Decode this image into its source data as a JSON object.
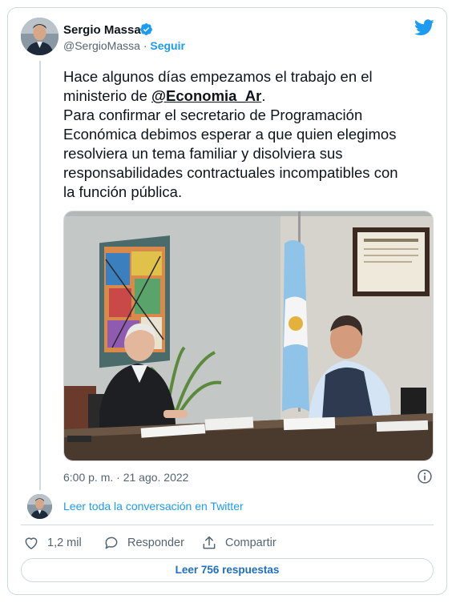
{
  "author": {
    "name": "Sergio Massa",
    "handle": "@SergioMassa",
    "separator": "·",
    "follow_label": "Seguir"
  },
  "tweet": {
    "text_before_mention": "Hace algunos días empezamos el trabajo en el\nministerio de ",
    "mention": "@Economia_Ar",
    "text_after_mention": ".\nPara confirmar el secretario de Programación\nEconómica debimos esperar a que quien elegimos\nresolviera un tema familiar y disolviera sus\nresponsabilidades contractuales incompatibles con\nla función pública.",
    "timestamp": "6:00 p. m. · 21 ago. 2022"
  },
  "conversation": {
    "read_label": "Leer toda la conversación en Twitter"
  },
  "actions": {
    "likes_count": "1,2 mil",
    "reply_label": "Responder",
    "share_label": "Compartir"
  },
  "replies_button": {
    "label": "Leer 756 respuestas"
  },
  "icons": {
    "verified": "verified-badge-icon",
    "logo": "twitter-bird-icon",
    "info": "info-icon",
    "like": "heart-icon",
    "reply": "speech-bubble-icon",
    "share": "share-upload-icon"
  },
  "colors": {
    "accent": "#1d9bf0",
    "text": "#0f1419",
    "muted": "#536471",
    "border": "#cfd9de"
  }
}
